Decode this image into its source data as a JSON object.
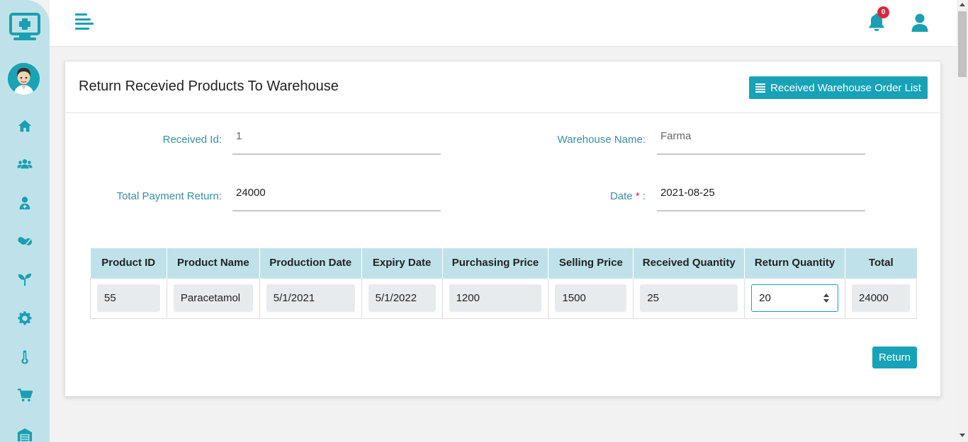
{
  "sidebar": {
    "logo_icon": "medical-monitor-icon",
    "avatar": "doctor-avatar",
    "items": [
      {
        "name": "home",
        "icon": "home-icon"
      },
      {
        "name": "users",
        "icon": "users-icon"
      },
      {
        "name": "doctor",
        "icon": "doctor-icon"
      },
      {
        "name": "medicines",
        "icon": "pills-icon"
      },
      {
        "name": "plants",
        "icon": "seedling-icon"
      },
      {
        "name": "settings",
        "icon": "gear-icon"
      },
      {
        "name": "temperature",
        "icon": "thermometer-icon"
      },
      {
        "name": "cart",
        "icon": "cart-icon"
      },
      {
        "name": "warehouse",
        "icon": "warehouse-icon"
      }
    ]
  },
  "header": {
    "notification_count": "0",
    "menu_icon": "menu-toggle-icon",
    "bell_icon": "bell-icon",
    "user_icon": "user-icon"
  },
  "card": {
    "title": "Return Recevied Products To Warehouse",
    "list_button_label": "Received Warehouse Order List"
  },
  "form": {
    "received_id_label": "Received Id:",
    "received_id_value": "1",
    "warehouse_name_label": "Warehouse Name:",
    "warehouse_name_value": "Farma",
    "total_payment_label": "Total Payment Return:",
    "total_payment_value": "24000",
    "date_label": "Date",
    "date_required_mark": "*",
    "date_colon": ":",
    "date_value": "2021-08-25"
  },
  "table": {
    "headers": [
      "Product ID",
      "Product Name",
      "Production Date",
      "Expiry Date",
      "Purchasing Price",
      "Selling Price",
      "Received Quantity",
      "Return Quantity",
      "Total"
    ],
    "row": {
      "product_id": "55",
      "product_name": "Paracetamol",
      "production_date": "5/1/2021",
      "expiry_date": "5/1/2022",
      "purchasing_price": "1200",
      "selling_price": "1500",
      "received_quantity": "25",
      "return_quantity": "20",
      "total": "24000"
    }
  },
  "actions": {
    "return_label": "Return"
  },
  "colors": {
    "accent": "#17a2b8",
    "sidebar_bg": "#bfe2ea",
    "label": "#3a8fa0",
    "badge": "#d6293e"
  }
}
